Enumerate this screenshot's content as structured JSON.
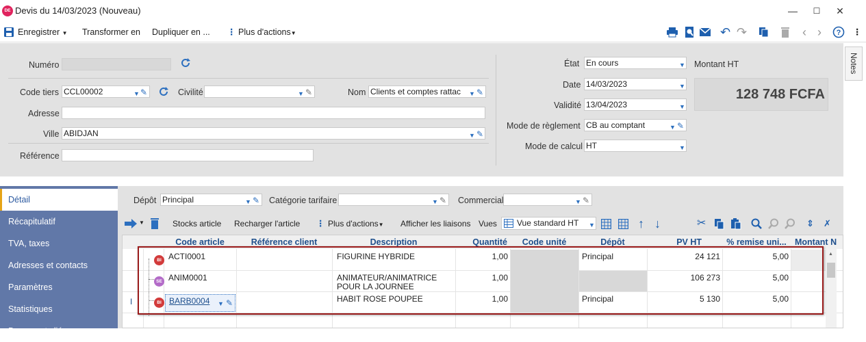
{
  "window": {
    "app_badge": "DE",
    "title": "Devis du 14/03/2023 (Nouveau)"
  },
  "toolbar": {
    "save": "Enregistrer",
    "transform": "Transformer en",
    "duplicate": "Dupliquer en ...",
    "more_actions": "Plus d'actions"
  },
  "form": {
    "numero_label": "Numéro",
    "numero_value": "",
    "code_tiers_label": "Code tiers",
    "code_tiers_value": "CCL00002",
    "civilite_label": "Civilité",
    "civilite_value": "",
    "nom_label": "Nom",
    "nom_value": "Clients et comptes rattac",
    "adresse_label": "Adresse",
    "adresse_value": "",
    "ville_label": "Ville",
    "ville_value": "ABIDJAN",
    "reference_label": "Référence",
    "reference_value": "",
    "etat_label": "État",
    "etat_value": "En cours",
    "date_label": "Date",
    "date_value": "14/03/2023",
    "validite_label": "Validité",
    "validite_value": "13/04/2023",
    "mode_reglement_label": "Mode de règlement",
    "mode_reglement_value": "CB au comptant",
    "mode_calcul_label": "Mode de calcul",
    "mode_calcul_value": "HT",
    "montant_label": "Montant HT",
    "montant_value": "128 748 FCFA"
  },
  "notes_tab": "Notes",
  "nav": {
    "items": [
      "Détail",
      "Récapitulatif",
      "TVA, taxes",
      "Adresses et contacts",
      "Paramètres",
      "Statistiques",
      "Documents liés"
    ],
    "active_index": 0
  },
  "detail": {
    "depot_label": "Dépôt",
    "depot_value": "Principal",
    "categorie_label": "Catégorie tarifaire",
    "categorie_value": "",
    "commercial_label": "Commercial",
    "commercial_value": "",
    "toolbar": {
      "stocks": "Stocks article",
      "reload": "Recharger l'article",
      "more_actions": "Plus d'actions",
      "links": "Afficher les liaisons",
      "views_label": "Vues",
      "view_value": "Vue standard HT"
    }
  },
  "grid": {
    "columns": [
      "Code article",
      "Référence client",
      "Description",
      "Quantité",
      "Code unité",
      "Dépôt",
      "PV HT",
      "% remise uni...",
      "Montant N"
    ],
    "rows": [
      {
        "badge": "BI",
        "badge_color": "#d23b3b",
        "code": "ACTI0001",
        "ref": "",
        "desc1": "FIGURINE HYBRIDE",
        "desc2": "",
        "qty": "1,00",
        "unit": "",
        "depot": "Principal",
        "pv": "24 121",
        "remise": "5,00"
      },
      {
        "badge": "SE",
        "badge_color": "#b36bc8",
        "code": "ANIM0001",
        "ref": "",
        "desc1": "ANIMATEUR/ANIMATRICE",
        "desc2": "POUR LA JOURNEE",
        "qty": "1,00",
        "unit": "",
        "depot": "",
        "pv": "106 273",
        "remise": "5,00"
      },
      {
        "badge": "BI",
        "badge_color": "#d23b3b",
        "code": "BARB0004",
        "ref": "",
        "desc1": "HABIT ROSE POUPEE",
        "desc2": "",
        "qty": "1,00",
        "unit": "",
        "depot": "Principal",
        "pv": "5 130",
        "remise": "5,00"
      }
    ],
    "edit_marker": "I"
  },
  "colors": {
    "accent_blue": "#2c6fbf",
    "nav_bg": "#6178a8",
    "form_bg": "#e2e2e2",
    "highlight_border": "#9a1b1b"
  }
}
